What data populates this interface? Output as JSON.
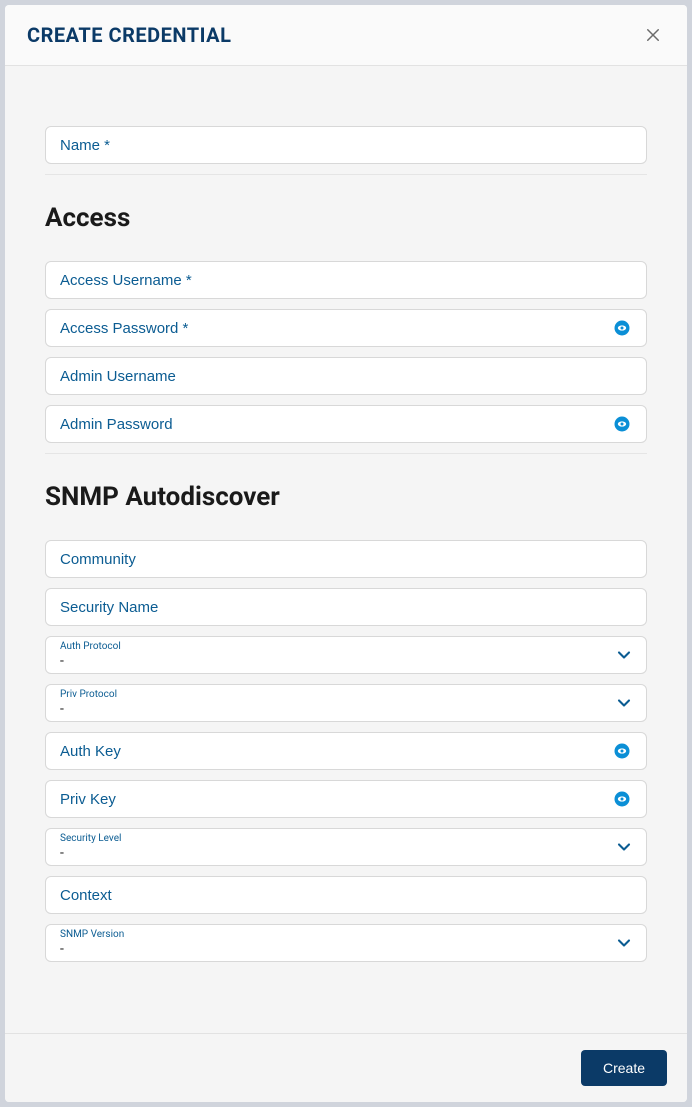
{
  "header": {
    "title": "CREATE CREDENTIAL"
  },
  "fields": {
    "name": {
      "placeholder": "Name *"
    }
  },
  "sections": {
    "access": {
      "title": "Access",
      "fields": {
        "access_username": {
          "placeholder": "Access Username *"
        },
        "access_password": {
          "placeholder": "Access Password *"
        },
        "admin_username": {
          "placeholder": "Admin Username"
        },
        "admin_password": {
          "placeholder": "Admin Password"
        }
      }
    },
    "snmp": {
      "title": "SNMP Autodiscover",
      "fields": {
        "community": {
          "placeholder": "Community"
        },
        "security_name": {
          "placeholder": "Security Name"
        },
        "auth_protocol": {
          "label": "Auth Protocol",
          "value": "-"
        },
        "priv_protocol": {
          "label": "Priv Protocol",
          "value": "-"
        },
        "auth_key": {
          "placeholder": "Auth Key"
        },
        "priv_key": {
          "placeholder": "Priv Key"
        },
        "security_level": {
          "label": "Security Level",
          "value": "-"
        },
        "context": {
          "placeholder": "Context"
        },
        "snmp_version": {
          "label": "SNMP Version",
          "value": "-"
        }
      }
    }
  },
  "footer": {
    "create_label": "Create"
  }
}
